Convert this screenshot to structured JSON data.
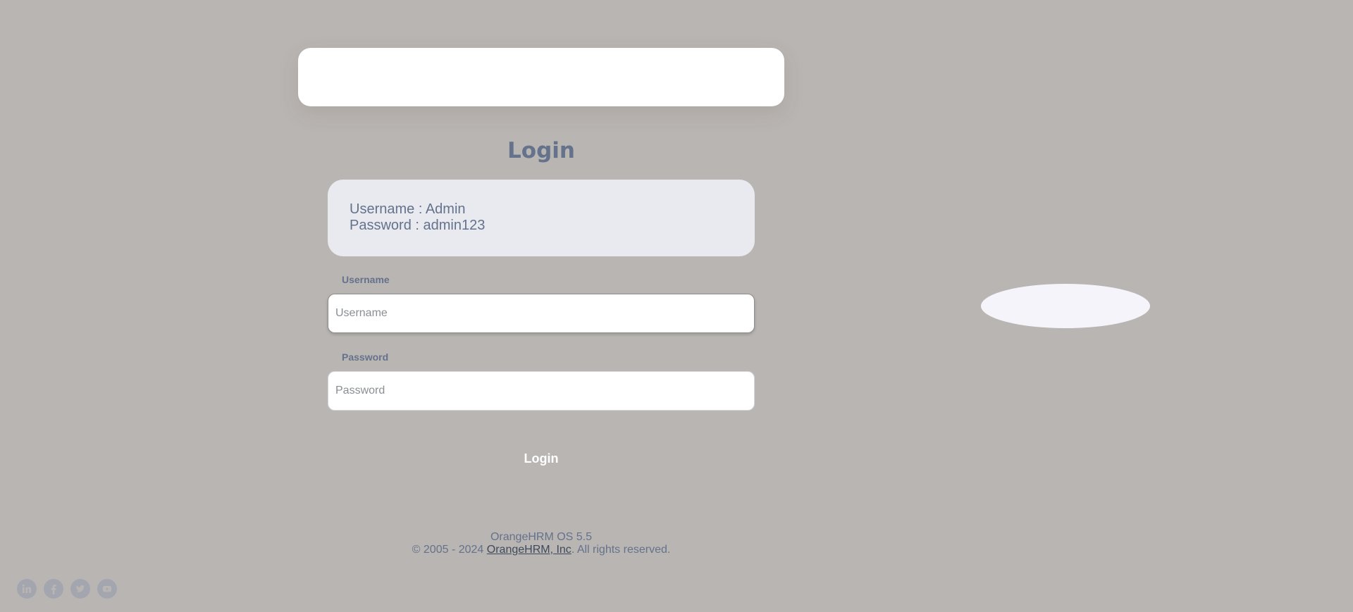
{
  "login": {
    "title": "Login",
    "credentials": {
      "username_line": "Username : Admin",
      "password_line": "Password : admin123"
    },
    "username": {
      "label": "Username",
      "value": "",
      "placeholder": "Username"
    },
    "password": {
      "label": "Password",
      "value": "",
      "placeholder": "Password"
    },
    "submit_label": "Login"
  },
  "footer": {
    "version": "OrangeHRM OS 5.5",
    "copyright_prefix": "© 2005 - 2024 ",
    "company_link": "OrangeHRM, Inc",
    "copyright_suffix": ". All rights reserved."
  },
  "social": [
    {
      "icon": "linkedin-icon"
    },
    {
      "icon": "facebook-icon"
    },
    {
      "icon": "twitter-icon"
    },
    {
      "icon": "youtube-icon"
    }
  ],
  "colors": {
    "background": "#b9b5b2",
    "text_primary": "#64728c",
    "card": "#ffffff",
    "credentials_box": "#e8eaef",
    "social_icon": "#a4a6af"
  }
}
